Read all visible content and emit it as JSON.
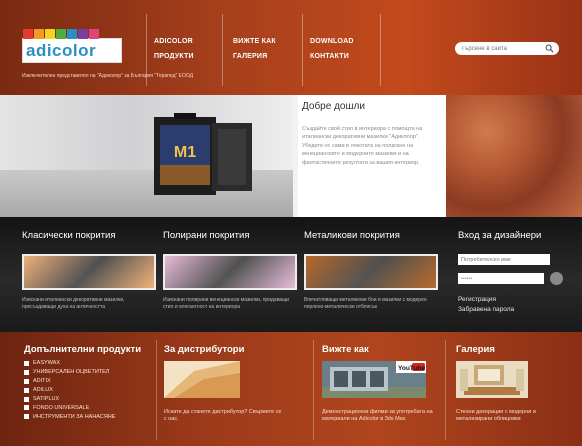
{
  "header": {
    "logo_text": "adicolor",
    "distributor": "Изключителен представител на \"Адиколор\" за България \"Терапед\" ЕООД",
    "nav": [
      {
        "line1": "ADICOLOR",
        "line2": "ПРОДУКТИ"
      },
      {
        "line1": "ВИЖТЕ КАК",
        "line2": "ГАЛЕРИЯ"
      },
      {
        "line1": "DOWNLOAD",
        "line2": "КОНТАКТИ"
      }
    ],
    "search_placeholder": "Търсене в сайта"
  },
  "hero": {
    "welcome_title": "Добре дошли",
    "welcome_body": "Създайте свой стил в интериора с помощта на италиански декоративни мазилки \"Адиколор\". Убедете се сами в лекотата на полагане на венецианските и модерните мазилки и на фантастичните резултати за вашия интериор.",
    "product_label": "M1"
  },
  "coatings": [
    {
      "title": "Класически покрития",
      "desc": "Изискани италиански декоративни мазилки, пресъздаващи духа на античността",
      "color": "#f0b27a"
    },
    {
      "title": "Полирани покрития",
      "desc": "Изискани полирани венециански мазилки, придаващи стил и елегантност на интериора",
      "color": "#e6bcd8"
    },
    {
      "title": "Металикови покрития",
      "desc": "Впечатляващи металикови бои и мазилки с модерен перлено-металически отблясък",
      "color": "#b86a2a"
    }
  ],
  "login": {
    "title": "Вход за дизайнери",
    "user_placeholder": "Потребителско име",
    "password_value": "••••••",
    "register": "Регистрация",
    "forgot": "Забравена парола"
  },
  "bottom": {
    "products_title": "Допълнителни продукти",
    "products": [
      "EASYWAX",
      "УНИВЕРСАЛЕН ОЦВЕТИТЕЛ",
      "ADITIX",
      "ADILUX",
      "SATIPLUX",
      "FONDO UNIVERSALE",
      "ИНСТРУМЕНТИ ЗА НАНАСЯНЕ"
    ],
    "distributors_title": "За дистрибутори",
    "distributors_desc": "Искате да станете дистрибутор? Свържете се с нас.",
    "howto_title": "Вижте как",
    "howto_desc": "Демонстрационни филми за употребата на материали на Adicolor в 3ds Max",
    "youtube_label": "YouTube",
    "gallery_title": "Галерия",
    "gallery_desc": "Стенни декорации с модерни и метализирани облицовки"
  },
  "colors": {
    "logo_chips": [
      "#e23b2e",
      "#f29a1f",
      "#f5d31f",
      "#4caf3d",
      "#2c8fc4",
      "#7a3ea0",
      "#e0447a"
    ],
    "header_bg": "#a8401c",
    "dark_band": "#1f1f1f"
  }
}
